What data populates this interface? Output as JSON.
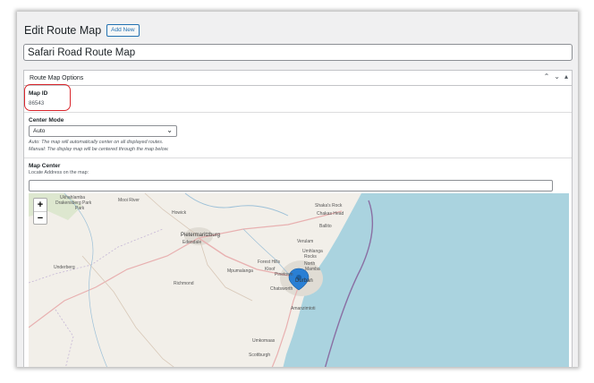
{
  "page": {
    "title": "Edit Route Map",
    "add_new_label": "Add New"
  },
  "title_field": {
    "value": "Safari Road Route Map"
  },
  "postbox": {
    "title": "Route Map Options",
    "handles": {
      "up": "⌃",
      "down": "⌄",
      "toggle": "▴"
    }
  },
  "map_id": {
    "label": "Map ID",
    "value": "86543"
  },
  "center_mode": {
    "label": "Center Mode",
    "selected": "Auto",
    "desc_auto": "Auto: The map will automatically center on all displayed routes.",
    "desc_manual": "Manual: The display map will be centered through the map below."
  },
  "map_center": {
    "label": "Map Center",
    "sublabel": "Locate Address on the map:",
    "address_value": ""
  },
  "map": {
    "zoom_in": "+",
    "zoom_out": "−",
    "places": {
      "park_top": "Ukhahlamba",
      "park": "Drakensberg Park",
      "park2": "Park",
      "mooi": "Mooi River",
      "howick": "Howick",
      "pmb": "Pietermaritzburg",
      "edendale": "Edendale",
      "underberg": "Underberg",
      "richmond": "Richmond",
      "mpumalanga": "Mpumalanga",
      "forest": "Forest Hills",
      "pinetown": "Pinetown",
      "durban": "Durban",
      "amanzimtoti": "Amanzimtoti",
      "chatsworth": "Chatsworth",
      "umkomaas": "Umkomaas",
      "scottburgh": "Scottburgh",
      "shaka": "Shaka's Rock",
      "shaka2": "Chakas Head",
      "ballito": "Ballito",
      "verulam": "Verulam",
      "umhlanga": "Umhlanga",
      "rocks": "Rocks",
      "north": "North",
      "mamba": "Mamba",
      "kloof": "Kloof"
    },
    "colors": {
      "land": "#f2efe9",
      "sea": "#aad3df",
      "urban": "#e0dcd4",
      "road": "#e8b0b0",
      "border": "#8a6fa3",
      "pin": "#2a7fd4"
    }
  }
}
